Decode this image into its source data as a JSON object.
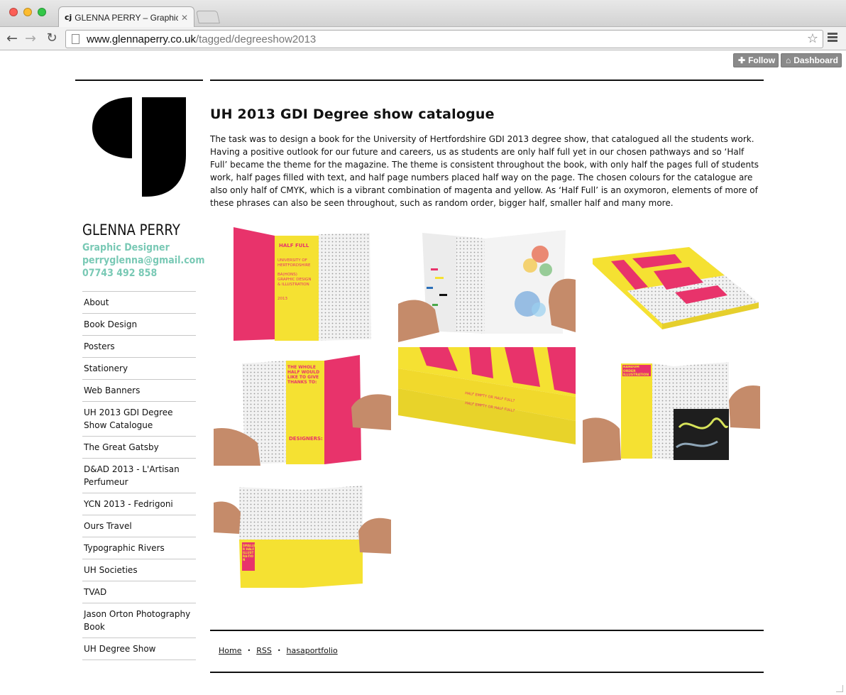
{
  "browser": {
    "tab_title": "GLENNA PERRY – Graphic D",
    "tab_favicon": "cj",
    "url_host": "www.glennaperry.co.uk",
    "url_path": "/tagged/degreeshow2013"
  },
  "tumblr": {
    "follow_label": "Follow",
    "dashboard_label": "Dashboard"
  },
  "sidebar": {
    "name": "GLENNA PERRY",
    "role": "Graphic Designer",
    "email": "perryglenna@gmail.com",
    "phone": "07743 492 858",
    "nav": [
      "About",
      "Book Design",
      "Posters",
      "Stationery",
      "Web Banners",
      "UH 2013 GDI Degree Show Catalogue",
      "The Great Gatsby",
      "D&AD 2013 - L'Artisan Perfumeur",
      "YCN 2013 - Fedrigoni",
      "Ours Travel",
      "Typographic Rivers",
      "UH Societies",
      "TVAD",
      "Jason Orton Photography Book",
      "UH Degree Show"
    ]
  },
  "post": {
    "title": "UH 2013 GDI Degree show catalogue",
    "body": "The task was to design a book for the University of Hertfordshire GDI 2013 degree show, that catalogued all the students work. Having a positive outlook for our future and careers, us as students are only half full yet in our chosen pathways and so ‘Half Full’ became the theme for the magazine. The theme is consistent throughout the book, with only half the pages full of students work, half pages filled with text, and half page numbers placed half way on the page. The chosen colours for the catalogue are also only half of CMYK, which is a vibrant combination of magenta and yellow. As ‘Half Full’ is an oxymoron, elements of more of these phrases can also be seen throughout, such as random order, bigger half, smaller half and many more."
  },
  "photos": {
    "p1": {
      "title": "HALF FULL",
      "lines": [
        "UNIVERSITY OF",
        "HERTFORDSHIRE",
        "BA(HONS)",
        "GRAPHIC DESIGN",
        "& ILLUSTRATION",
        "2013"
      ]
    },
    "p4": {
      "heading": "THE WHOLE HALF WOULD LIKE TO GIVE THANKS TO:",
      "sub": "DESIGNERS:"
    },
    "p5": {
      "spine1": "HALF EMPTY OR HALF FULL?",
      "spine2": "HALF EMPTY OR HALF FULL?"
    },
    "p6": {
      "heading": "RANDOM ORDER ILLUSTRATION"
    },
    "p7": {
      "heading": "SMALLER HALF ILLUSTRA-TION"
    }
  },
  "footer": {
    "home": "Home",
    "rss": "RSS",
    "hasaportfolio": "hasaportfolio"
  },
  "colors": {
    "accent_teal": "#79c9b5",
    "magenta": "#e8336b",
    "yellow": "#f5e132"
  }
}
